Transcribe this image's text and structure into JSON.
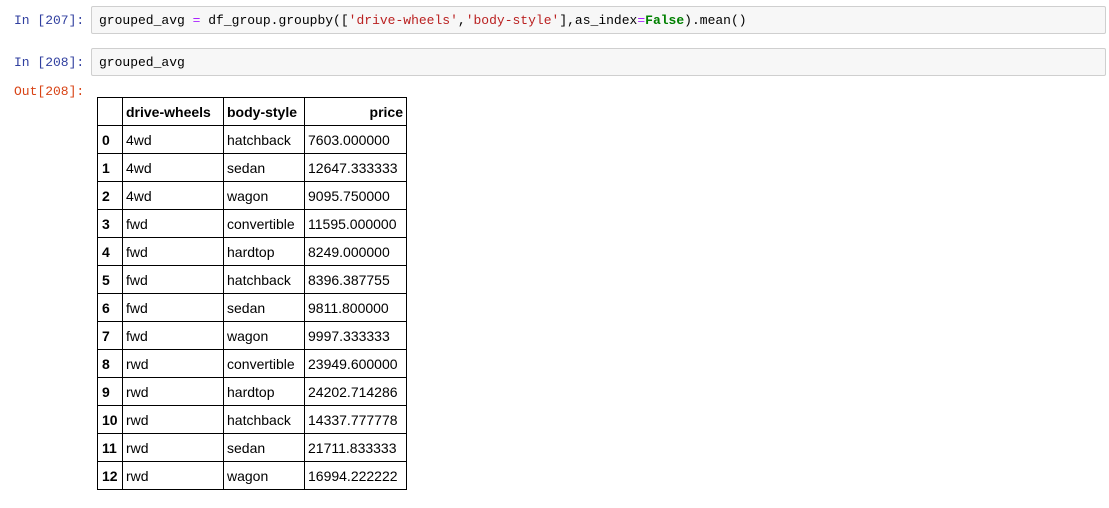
{
  "cells": [
    {
      "prompt": "In [207]:",
      "code": {
        "t1": "grouped_avg ",
        "t2": "=",
        "t3": " df_group.groupby([",
        "t4": "'drive-wheels'",
        "t5": ",",
        "t6": "'body-style'",
        "t7": "],as_index",
        "t8": "=",
        "t9": "False",
        "t10": ").mean()"
      }
    },
    {
      "prompt": "In [208]:",
      "code": {
        "t1": "grouped_avg"
      }
    }
  ],
  "output": {
    "prompt": "Out[208]:",
    "columns": [
      "",
      "drive-wheels",
      "body-style",
      "price"
    ],
    "rows": [
      [
        "0",
        "4wd",
        "hatchback",
        "7603.000000"
      ],
      [
        "1",
        "4wd",
        "sedan",
        "12647.333333"
      ],
      [
        "2",
        "4wd",
        "wagon",
        "9095.750000"
      ],
      [
        "3",
        "fwd",
        "convertible",
        "11595.000000"
      ],
      [
        "4",
        "fwd",
        "hardtop",
        "8249.000000"
      ],
      [
        "5",
        "fwd",
        "hatchback",
        "8396.387755"
      ],
      [
        "6",
        "fwd",
        "sedan",
        "9811.800000"
      ],
      [
        "7",
        "fwd",
        "wagon",
        "9997.333333"
      ],
      [
        "8",
        "rwd",
        "convertible",
        "23949.600000"
      ],
      [
        "9",
        "rwd",
        "hardtop",
        "24202.714286"
      ],
      [
        "10",
        "rwd",
        "hatchback",
        "14337.777778"
      ],
      [
        "11",
        "rwd",
        "sedan",
        "21711.833333"
      ],
      [
        "12",
        "rwd",
        "wagon",
        "16994.222222"
      ]
    ]
  }
}
